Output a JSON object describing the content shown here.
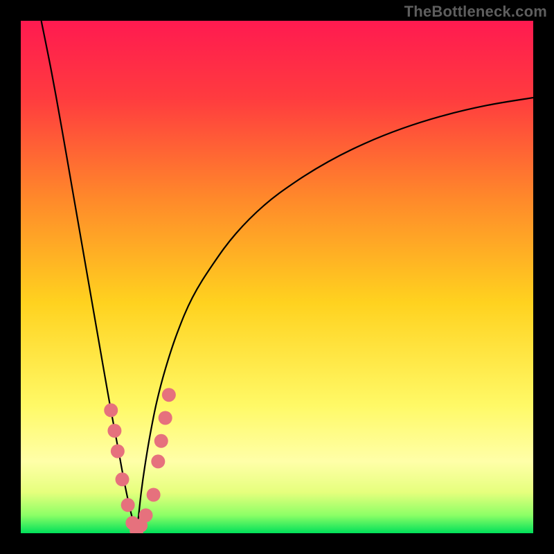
{
  "watermark": "TheBottleneck.com",
  "chart_data": {
    "type": "line",
    "title": "",
    "xlabel": "",
    "ylabel": "",
    "xlim": [
      0,
      100
    ],
    "ylim": [
      0,
      100
    ],
    "grid": false,
    "legend": false,
    "gradient_stops": [
      {
        "offset": 0.0,
        "color": "#ff1a50"
      },
      {
        "offset": 0.15,
        "color": "#ff3b3f"
      },
      {
        "offset": 0.35,
        "color": "#ff8a2a"
      },
      {
        "offset": 0.55,
        "color": "#ffd21f"
      },
      {
        "offset": 0.75,
        "color": "#fff966"
      },
      {
        "offset": 0.86,
        "color": "#ffffa8"
      },
      {
        "offset": 0.92,
        "color": "#e6ff7d"
      },
      {
        "offset": 0.965,
        "color": "#8cff66"
      },
      {
        "offset": 1.0,
        "color": "#00e05a"
      }
    ],
    "series": [
      {
        "name": "curve-left",
        "x": [
          4,
          6,
          8,
          10,
          12,
          14,
          16,
          17.5,
          19,
          20.3,
          21.5,
          22.6
        ],
        "y": [
          100,
          90,
          79,
          67.5,
          56,
          44.5,
          33,
          24.5,
          16.5,
          9.5,
          4,
          0
        ]
      },
      {
        "name": "curve-right",
        "x": [
          22.6,
          23.0,
          23.5,
          24.2,
          25.2,
          26.5,
          28.2,
          30.5,
          33.5,
          37.5,
          42.0,
          47.5,
          53.5,
          60.0,
          67.0,
          74.5,
          82.5,
          91.0,
          100.0
        ],
        "y": [
          0,
          3.5,
          8.0,
          13.0,
          19.0,
          25.5,
          32.0,
          39.0,
          46.0,
          52.5,
          58.5,
          64.0,
          68.5,
          72.5,
          76.0,
          79.0,
          81.5,
          83.5,
          85.0
        ]
      }
    ],
    "markers": {
      "name": "dots-pink",
      "color": "#e6717d",
      "radius": 10,
      "points": [
        {
          "x": 17.6,
          "y": 24.0
        },
        {
          "x": 18.3,
          "y": 20.0
        },
        {
          "x": 18.9,
          "y": 16.0
        },
        {
          "x": 19.8,
          "y": 10.5
        },
        {
          "x": 20.9,
          "y": 5.5
        },
        {
          "x": 21.8,
          "y": 2.0
        },
        {
          "x": 22.6,
          "y": 0.5
        },
        {
          "x": 23.4,
          "y": 1.5
        },
        {
          "x": 24.4,
          "y": 3.5
        },
        {
          "x": 25.9,
          "y": 7.5
        },
        {
          "x": 26.8,
          "y": 14.0
        },
        {
          "x": 27.4,
          "y": 18.0
        },
        {
          "x": 28.2,
          "y": 22.5
        },
        {
          "x": 28.9,
          "y": 27.0
        }
      ]
    }
  }
}
